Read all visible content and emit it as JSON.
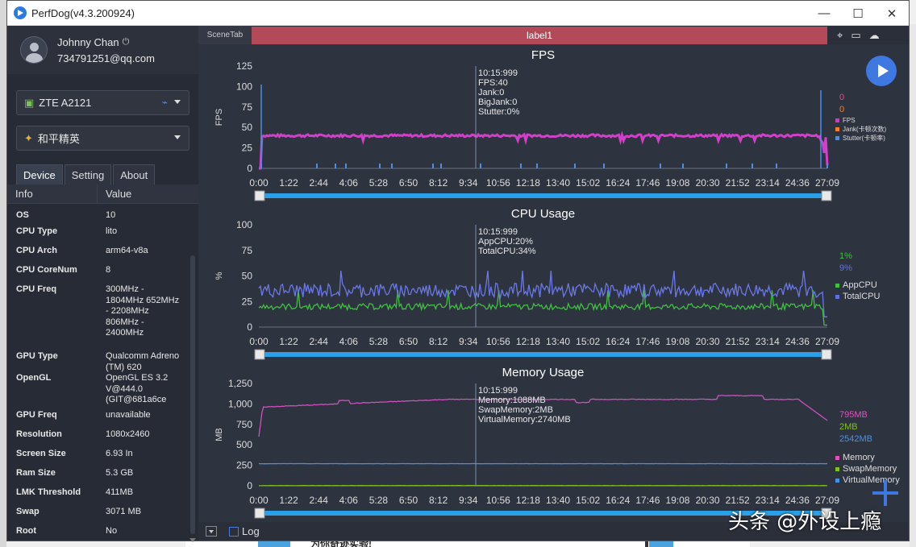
{
  "window": {
    "title": "PerfDog(v4.3.200924)",
    "controls": [
      "—",
      "☐",
      "✕"
    ]
  },
  "profile": {
    "name": "Johnny Chan",
    "email": "734791251@qq.com"
  },
  "device_select": {
    "label": "ZTE A2121"
  },
  "app_select": {
    "label": "和平精英"
  },
  "tabs": [
    "Device",
    "Setting",
    "About"
  ],
  "info_table": {
    "headers": [
      "Info",
      "Value"
    ],
    "rows": [
      {
        "key": "OS",
        "value": "10"
      },
      {
        "key": "CPU Type",
        "value": "lito"
      },
      {
        "key": "CPU Arch",
        "value": "arm64-v8a"
      },
      {
        "key": "CPU CoreNum",
        "value": "8"
      },
      {
        "key": "CPU Freq",
        "value": "300MHz - 1804MHz 652MHz - 2208MHz 806MHz - 2400MHz"
      },
      {
        "key": "GPU Type",
        "value": "Qualcomm Adreno (TM) 620"
      },
      {
        "key": "OpenGL",
        "value": "OpenGL ES 3.2 V@444.0 (GIT@681a6ce"
      },
      {
        "key": "GPU Freq",
        "value": "unavailable"
      },
      {
        "key": "Resolution",
        "value": "1080x2460"
      },
      {
        "key": "Screen Size",
        "value": "6.93 In"
      },
      {
        "key": "Ram Size",
        "value": "5.3 GB"
      },
      {
        "key": "LMK Threshold",
        "value": "411MB"
      },
      {
        "key": "Swap",
        "value": "3071 MB"
      },
      {
        "key": "Root",
        "value": "No"
      }
    ]
  },
  "scene": {
    "tab": "SceneTab",
    "label": "label1"
  },
  "log_label": "Log",
  "watermark": "头条 @外设上瘾",
  "x_ticks": [
    "0:00",
    "1:22",
    "2:44",
    "4:06",
    "5:28",
    "6:50",
    "8:12",
    "9:34",
    "10:56",
    "12:18",
    "13:40",
    "15:02",
    "16:24",
    "17:46",
    "19:08",
    "20:30",
    "21:52",
    "23:14",
    "24:36",
    "27:09"
  ],
  "chart_data": [
    {
      "type": "line",
      "title": "FPS",
      "ylabel": "FPS",
      "ylim": [
        0,
        125
      ],
      "yticks": [
        "125",
        "100",
        "75",
        "50",
        "25",
        "0"
      ],
      "cursor_time": "10:15:999",
      "tooltip": [
        "10:15:999",
        "FPS:40",
        "Jank:0",
        "BigJank:0",
        "Stutter:0%"
      ],
      "current_values": [
        {
          "value": "0",
          "color": "#e0508a"
        },
        {
          "value": "0",
          "color": "#f08030"
        }
      ],
      "legend": [
        {
          "name": "FPS",
          "color": "#c040c0"
        },
        {
          "name": "Jank(卡顿次数)",
          "color": "#f08030"
        },
        {
          "name": "Stutter(卡顿率)",
          "color": "#4a90e2"
        }
      ],
      "series": [
        {
          "name": "FPS",
          "color": "#d040c8",
          "baseline": 40
        }
      ]
    },
    {
      "type": "line",
      "title": "CPU Usage",
      "ylabel": "%",
      "ylim": [
        0,
        100
      ],
      "yticks": [
        "100",
        "75",
        "50",
        "25",
        "0"
      ],
      "cursor_time": "10:15:999",
      "tooltip": [
        "10:15:999",
        "AppCPU:20%",
        "TotalCPU:34%"
      ],
      "current_values": [
        {
          "value": "1%",
          "color": "#40c040"
        },
        {
          "value": "9%",
          "color": "#6070e0"
        }
      ],
      "legend": [
        {
          "name": "AppCPU",
          "color": "#40c040"
        },
        {
          "name": "TotalCPU",
          "color": "#6070e0"
        }
      ],
      "series": [
        {
          "name": "AppCPU",
          "color": "#40c040",
          "baseline": 20
        },
        {
          "name": "TotalCPU",
          "color": "#6a78e8",
          "baseline": 36
        }
      ]
    },
    {
      "type": "line",
      "title": "Memory Usage",
      "ylabel": "MB",
      "ylim": [
        0,
        1250
      ],
      "yticks": [
        "1,250",
        "1,000",
        "750",
        "500",
        "250",
        "0"
      ],
      "cursor_time": "10:15:999",
      "tooltip": [
        "10:15:999",
        "Memory:1088MB",
        "SwapMemory:2MB",
        "VirtualMemory:2740MB"
      ],
      "current_values": [
        {
          "value": "795MB",
          "color": "#e050c0"
        },
        {
          "value": "2MB",
          "color": "#80c020"
        },
        {
          "value": "2542MB",
          "color": "#4a90e2"
        }
      ],
      "legend": [
        {
          "name": "Memory",
          "color": "#e050c0"
        },
        {
          "name": "SwapMemory",
          "color": "#80c020"
        },
        {
          "name": "VirtualMemory",
          "color": "#4a90e2"
        }
      ],
      "series": [
        {
          "name": "Memory",
          "color": "#d050c0",
          "baseline": 1050
        },
        {
          "name": "SwapMemory",
          "color": "#80c020",
          "baseline": 2
        },
        {
          "name": "VirtualMemory",
          "color": "#4a90e2",
          "baseline": 270
        }
      ]
    }
  ]
}
